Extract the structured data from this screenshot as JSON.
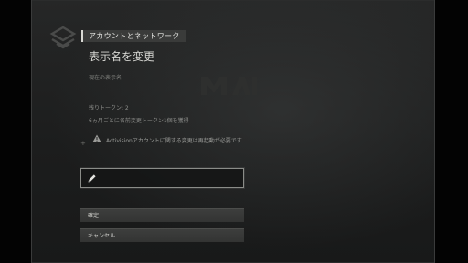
{
  "header": {
    "section": "アカウントとネットワーク"
  },
  "page": {
    "title": "表示名を変更",
    "current_name_label": "現在の表示名"
  },
  "tokens": {
    "remaining": "残りトークン: 2",
    "info": "6ヵ月ごとに名前変更トークン1個を獲得"
  },
  "warning": {
    "text": "Activisionアカウントに関する変更は再起動が必要です"
  },
  "name_field": {
    "value": "",
    "placeholder": ""
  },
  "buttons": {
    "confirm": "確定",
    "cancel": "キャンセル"
  },
  "icons": {
    "emblem": "game-emblem-icon",
    "warning": "warning-triangle-icon",
    "edit": "pencil-icon",
    "watermark": "mwii-logo"
  },
  "colors": {
    "panel": "#222323",
    "text_primary": "#d8d8d4",
    "text_secondary": "#8d8e8b",
    "field_border": "#8a8c88",
    "button": "#3a3b3a"
  }
}
